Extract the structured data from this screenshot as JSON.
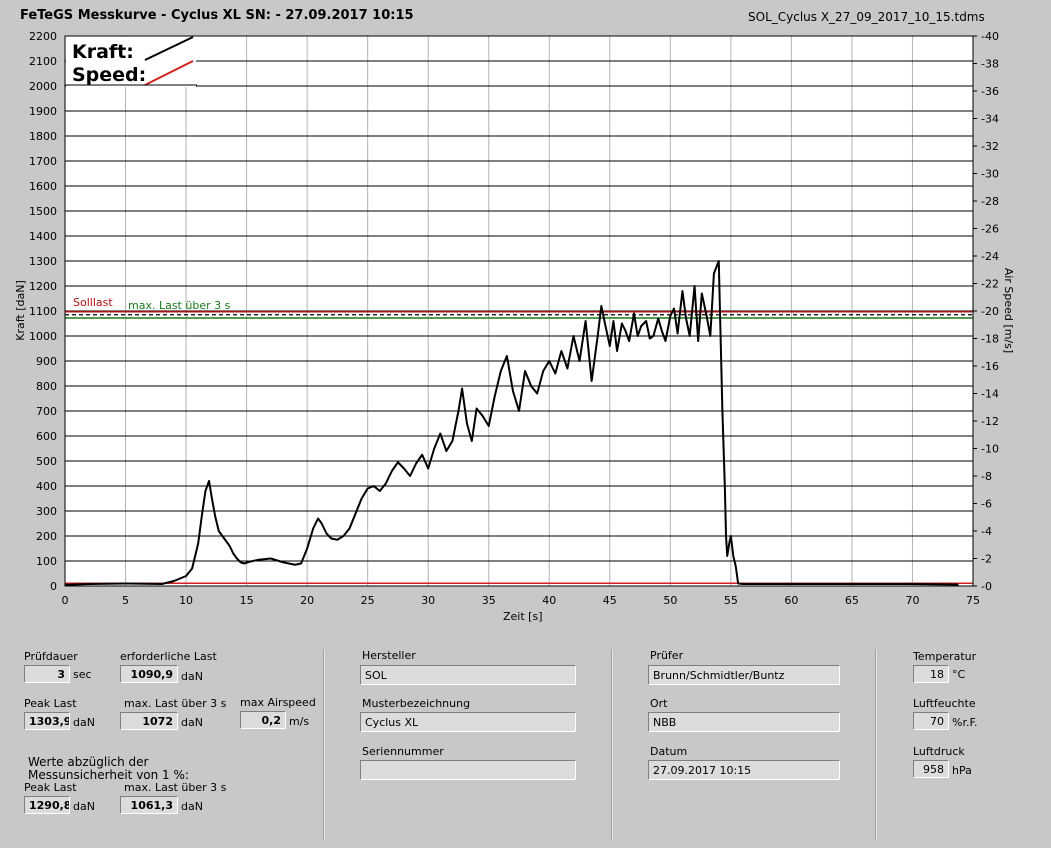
{
  "header": {
    "title": "FeTeGS Messkurve - Cyclus XL  SN:  - 27.09.2017 10:15",
    "filename": "SOL_Cyclus X_27_09_2017_10_15.tdms"
  },
  "legend": {
    "kraft": "Kraft:",
    "speed": "Speed:"
  },
  "colors": {
    "kraft": "#000000",
    "speed": "#d02020",
    "solllast": "#b01010",
    "maxlast": "#1a7a1a",
    "plot_bg": "#ffffff",
    "panel_bg": "#c8c8c8"
  },
  "chart_data": {
    "type": "line",
    "xlabel": "Zeit [s]",
    "ylabel": "Kraft [daN]",
    "y2label": "Air Speed [m/s]",
    "xlim": [
      0,
      75
    ],
    "ylim": [
      0,
      2200
    ],
    "y2lim": [
      0,
      40
    ],
    "x_ticks": [
      "0",
      "5",
      "10",
      "15",
      "20",
      "25",
      "30",
      "35",
      "40",
      "45",
      "50",
      "55",
      "60",
      "65",
      "70",
      "75"
    ],
    "y_ticks": [
      "0",
      "100",
      "200",
      "300",
      "400",
      "500",
      "600",
      "700",
      "800",
      "900",
      "1000",
      "1100",
      "1200",
      "1300",
      "1400",
      "1500",
      "1600",
      "1700",
      "1800",
      "1900",
      "2000",
      "2100",
      "2200"
    ],
    "y2_ticks": [
      "0",
      "2",
      "4",
      "6",
      "8",
      "10",
      "12",
      "14",
      "16",
      "18",
      "20",
      "22",
      "24",
      "26",
      "28",
      "30",
      "32",
      "34",
      "36",
      "38",
      "40"
    ],
    "grid": true,
    "reference_lines": [
      {
        "label": "Solllast",
        "y": 1090.9
      },
      {
        "label": "max. Last über  3 s",
        "y": 1072
      }
    ],
    "series": [
      {
        "name": "Kraft",
        "axis": "left",
        "x": [
          0,
          2,
          5,
          8,
          9,
          10,
          10.5,
          11,
          11.3,
          11.6,
          11.9,
          12.1,
          12.4,
          12.7,
          13,
          13.3,
          13.6,
          13.9,
          14.2,
          14.5,
          14.8,
          15.1,
          15.5,
          16,
          17,
          18,
          19,
          19.5,
          20,
          20.5,
          20.9,
          21.2,
          21.6,
          22,
          22.5,
          23,
          23.5,
          24,
          24.5,
          25,
          25.5,
          26,
          26.5,
          27,
          27.5,
          28,
          28.5,
          29,
          29.5,
          30,
          30.5,
          31,
          31.5,
          32,
          32.5,
          32.8,
          33.2,
          33.6,
          34,
          34.5,
          35,
          35.5,
          36,
          36.5,
          37,
          37.5,
          38,
          38.5,
          39,
          39.5,
          40,
          40.5,
          41,
          41.5,
          42,
          42.5,
          43,
          43.5,
          44,
          44.3,
          44.6,
          45,
          45.3,
          45.6,
          46,
          46.3,
          46.6,
          47,
          47.3,
          47.6,
          48,
          48.3,
          48.6,
          49,
          49.3,
          49.6,
          50,
          50.3,
          50.6,
          51,
          51.3,
          51.6,
          52,
          52.3,
          52.6,
          53,
          53.3,
          53.6,
          54,
          54.3,
          54.5,
          54.6,
          54.7,
          54.8,
          54.9,
          55,
          55.1,
          55.2,
          55.4,
          55.6,
          56,
          58,
          60,
          65,
          70,
          73.8
        ],
        "y": [
          5,
          8,
          10,
          8,
          20,
          40,
          70,
          170,
          280,
          380,
          420,
          360,
          280,
          220,
          200,
          180,
          160,
          130,
          110,
          95,
          90,
          95,
          100,
          105,
          110,
          95,
          85,
          90,
          150,
          230,
          270,
          250,
          210,
          190,
          185,
          200,
          230,
          290,
          350,
          390,
          400,
          380,
          410,
          460,
          495,
          470,
          440,
          490,
          525,
          470,
          550,
          610,
          540,
          580,
          700,
          790,
          650,
          580,
          710,
          680,
          640,
          760,
          860,
          920,
          780,
          700,
          860,
          800,
          770,
          860,
          900,
          850,
          940,
          870,
          1000,
          900,
          1060,
          820,
          1000,
          1120,
          1050,
          960,
          1060,
          940,
          1050,
          1020,
          980,
          1090,
          1000,
          1040,
          1060,
          990,
          1000,
          1070,
          1020,
          980,
          1080,
          1110,
          1010,
          1180,
          1070,
          1000,
          1200,
          980,
          1170,
          1080,
          1000,
          1250,
          1300,
          700,
          400,
          200,
          120,
          150,
          180,
          200,
          160,
          120,
          80,
          10,
          8,
          8,
          8,
          8,
          8,
          6
        ]
      },
      {
        "name": "Speed",
        "axis": "right",
        "x": [
          0,
          75
        ],
        "y": [
          0.2,
          0.2
        ]
      }
    ]
  },
  "stats": {
    "pruefdauer": {
      "label": "Prüfdauer",
      "value": "3",
      "unit": "sec"
    },
    "erf_last": {
      "label": "erforderliche Last",
      "value": "1090,9",
      "unit": "daN"
    },
    "peak_last": {
      "label": "Peak Last",
      "value": "1303,9",
      "unit": "daN"
    },
    "max_last": {
      "label": "max. Last über  3 s",
      "value": "1072",
      "unit": "daN"
    },
    "max_airspeed": {
      "label": "max Airspeed",
      "value": "0,2",
      "unit": "m/s"
    },
    "note_line1": "Werte abzüglich der",
    "note_line2": "Messunsicherheit von 1  %:",
    "peak_last2": {
      "label": "Peak Last",
      "value": "1290,8",
      "unit": "daN"
    },
    "max_last2": {
      "label": "max. Last über  3 s",
      "value": "1061,3",
      "unit": "daN"
    }
  },
  "info": {
    "hersteller": {
      "label": "Hersteller",
      "value": "SOL"
    },
    "muster": {
      "label": "Musterbezeichnung",
      "value": "Cyclus XL"
    },
    "serie": {
      "label": "Seriennummer",
      "value": ""
    },
    "pruefer": {
      "label": "Prüfer",
      "value": "Brunn/Schmidtler/Buntz"
    },
    "ort": {
      "label": "Ort",
      "value": "NBB"
    },
    "datum": {
      "label": "Datum",
      "value": "27.09.2017 10:15"
    }
  },
  "env": {
    "temperatur": {
      "label": "Temperatur",
      "value": "18",
      "unit": "°C"
    },
    "luftfeuchte": {
      "label": "Luftfeuchte",
      "value": "70",
      "unit": "%r.F."
    },
    "luftdruck": {
      "label": "Luftdruck",
      "value": "958",
      "unit": "hPa"
    }
  }
}
